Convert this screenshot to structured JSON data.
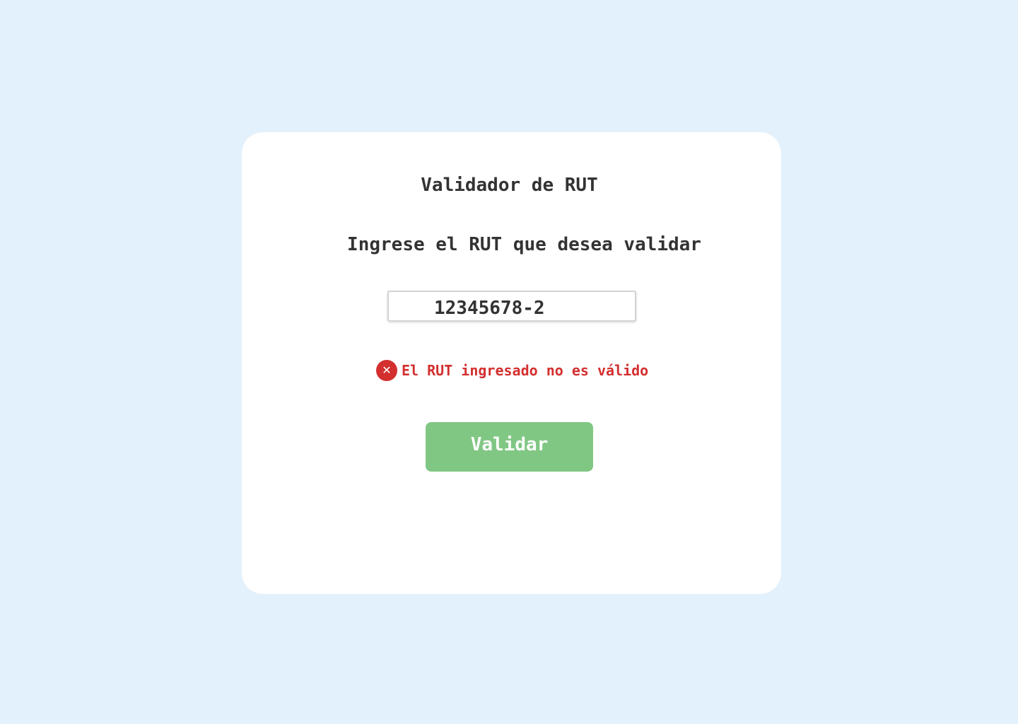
{
  "card": {
    "title": "Validador de RUT",
    "prompt": "Ingrese el RUT que desea validar"
  },
  "rut_input": {
    "value": "12345678-2",
    "placeholder": ""
  },
  "error": {
    "icon": "error-x-icon",
    "icon_glyph": "✕",
    "message": "El RUT ingresado no es válido"
  },
  "button": {
    "label": "Validar"
  },
  "colors": {
    "background": "#e3f1fc",
    "card": "#ffffff",
    "text": "#333333",
    "error": "#d32f2f",
    "button": "#81c784",
    "button_text": "#ffffff"
  }
}
